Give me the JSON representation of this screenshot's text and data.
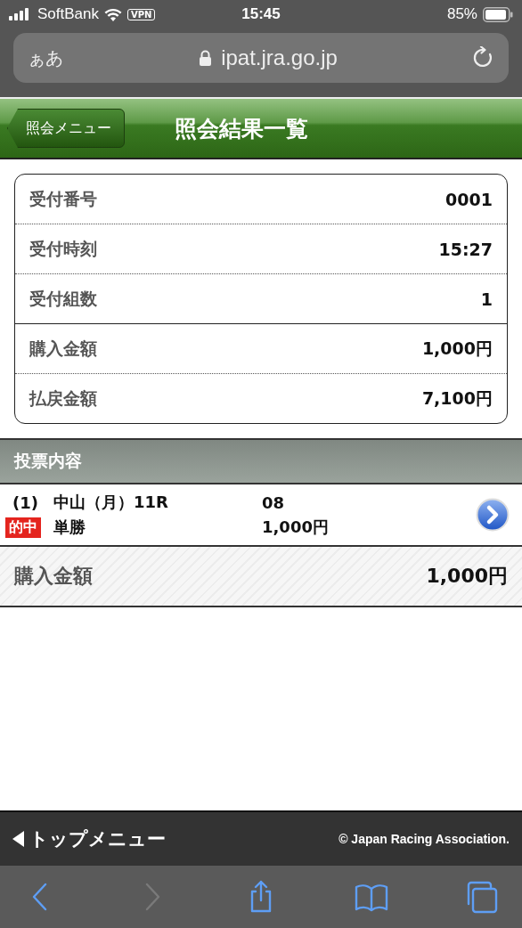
{
  "status_bar": {
    "carrier": "SoftBank",
    "vpn": "VPN",
    "time": "15:45",
    "battery": "85%"
  },
  "url_bar": {
    "text_size": "ぁあ",
    "url": "ipat.jra.go.jp"
  },
  "header": {
    "back": "照会メニュー",
    "title": "照会結果一覧"
  },
  "summary": {
    "groups": [
      [
        {
          "label": "受付番号",
          "value": "0001"
        },
        {
          "label": "受付時刻",
          "value": "15:27"
        },
        {
          "label": "受付組数",
          "value": "1"
        }
      ],
      [
        {
          "label": "購入金額",
          "value": "1,000円"
        },
        {
          "label": "払戻金額",
          "value": "7,100円"
        }
      ]
    ]
  },
  "section": {
    "title": "投票内容"
  },
  "bets": [
    {
      "number": "(1)",
      "badge": "的中",
      "race": "中山（月）11R",
      "bet_type": "単勝",
      "selection": "08",
      "amount": "1,000円"
    }
  ],
  "total": {
    "label": "購入金額",
    "value": "1,000円"
  },
  "footer": {
    "top_menu": "トップメニュー",
    "copyright": "© Japan Racing Association."
  },
  "toolbar": [
    {
      "kind": "back",
      "disabled": false
    },
    {
      "kind": "forward",
      "disabled": true
    },
    {
      "kind": "share",
      "disabled": false
    },
    {
      "kind": "bookmarks",
      "disabled": false
    },
    {
      "kind": "tabs",
      "disabled": false
    }
  ]
}
